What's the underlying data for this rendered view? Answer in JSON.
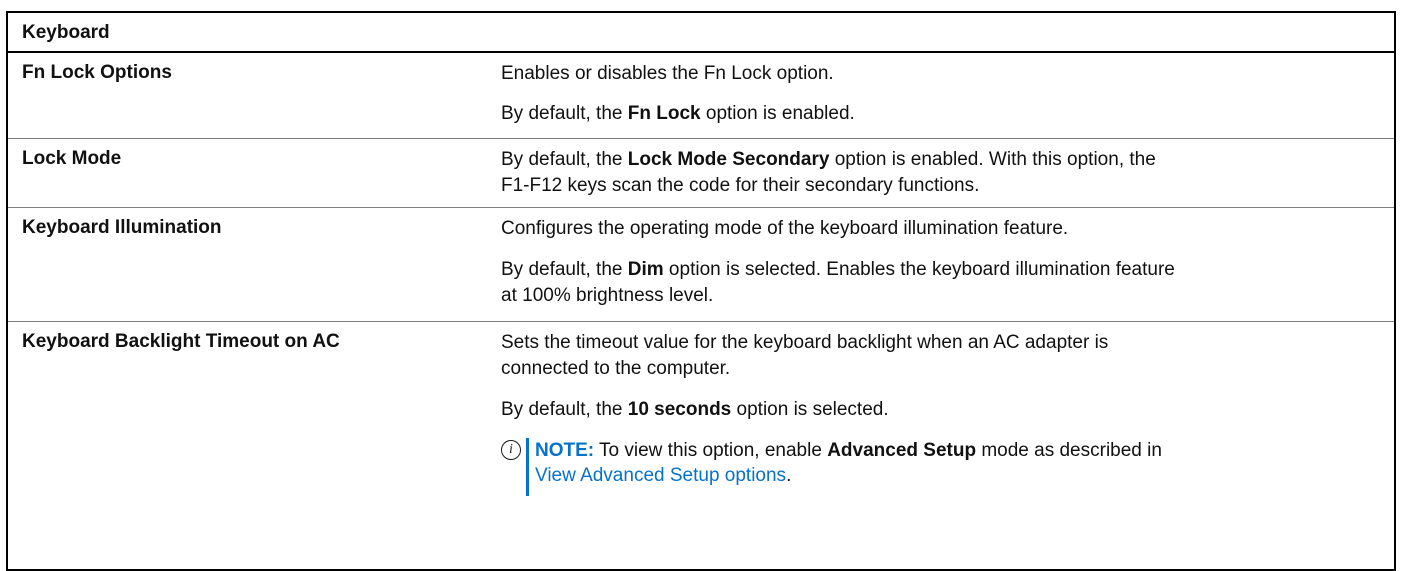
{
  "table": {
    "title": "Keyboard",
    "rows": [
      {
        "label": "Fn Lock Options",
        "p1": "Enables or disables the Fn Lock option.",
        "p2": {
          "pre": "By default, the ",
          "bold": "Fn Lock",
          "post": " option is enabled."
        }
      },
      {
        "label": "Lock Mode",
        "p1": {
          "pre": "By default, the ",
          "bold": "Lock Mode Secondary",
          "post": " option is enabled. With this option, the"
        },
        "p1b": "F1-F12 keys scan the code for their secondary functions."
      },
      {
        "label": "Keyboard Illumination",
        "p1": "Configures the operating mode of the keyboard illumination feature.",
        "p2": {
          "pre": "By default, the ",
          "bold": "Dim",
          "post": " option is selected. Enables the keyboard illumination feature"
        },
        "p2b": "at 100% brightness level."
      },
      {
        "label": "Keyboard Backlight Timeout on AC",
        "p1": "Sets the timeout value for the keyboard backlight when an AC adapter is",
        "p1b": "connected to the computer.",
        "p2": {
          "pre": "By default, the ",
          "bold": "10 seconds",
          "post": " option is selected."
        },
        "note": {
          "icon": "info-icon",
          "label": "NOTE:",
          "pre": " To view this option, enable ",
          "bold": "Advanced Setup",
          "post": " mode as described in",
          "link": "View Advanced Setup options",
          "end": "."
        }
      }
    ]
  },
  "colors": {
    "link": "#0672cb",
    "border": "#000000",
    "divider": "#808080"
  }
}
